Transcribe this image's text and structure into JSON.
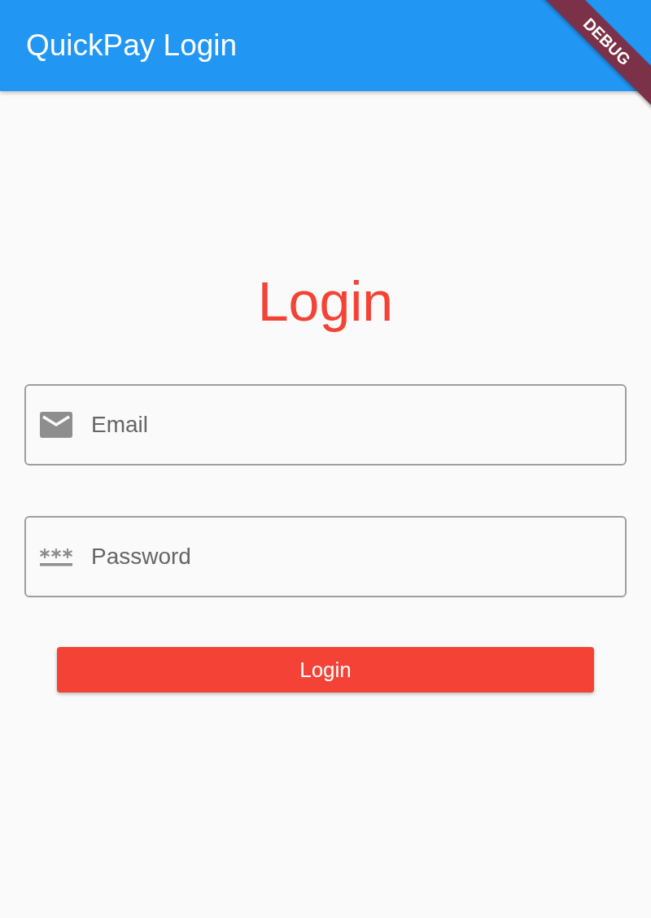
{
  "app_bar": {
    "title": "QuickPay Login"
  },
  "debug_banner": "DEBUG",
  "heading": "Login",
  "fields": [
    {
      "kind": "email",
      "placeholder": "Email"
    },
    {
      "kind": "password",
      "placeholder": "Password"
    }
  ],
  "login_button": "Login"
}
